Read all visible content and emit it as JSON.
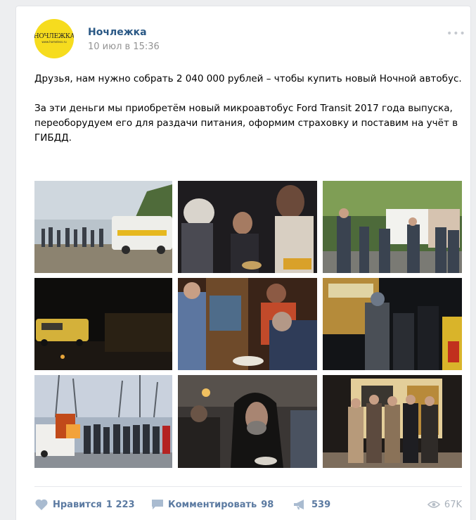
{
  "post": {
    "author": "Ночлежка",
    "date": "10 июл в 15:36",
    "avatar_word": "НОЧЛЕЖКА",
    "avatar_url": "www.homeless.ru",
    "paragraph1": "Друзья, нам нужно собрать 2 040 000 рублей – чтобы купить новый Ночной автобус.",
    "paragraph2": "За эти деньги мы приобретём новый микроавтобус Ford Transit 2017 года выпуска, переоборудуем его для раздачи питания, оформим страховку и поставим на учёт в ГИБДД.",
    "photos": [
      "bus-with-queue-photo",
      "people-receiving-food-photo",
      "volunteers-outdoors-photo",
      "bus-at-night-photo",
      "volunteer-serving-photo",
      "night-crowd-photo",
      "winter-queue-photo",
      "man-in-hood-photo",
      "volunteers-group-photo"
    ]
  },
  "actions": {
    "like_label": "Нравится",
    "like_count": "1 223",
    "comment_label": "Комментировать",
    "comment_count": "98",
    "share_count": "539",
    "views": "67K"
  },
  "colors": {
    "link": "#2a5885",
    "action": "#5b7aa1",
    "muted": "#939393",
    "avatar_bg": "#f6dc1e"
  }
}
